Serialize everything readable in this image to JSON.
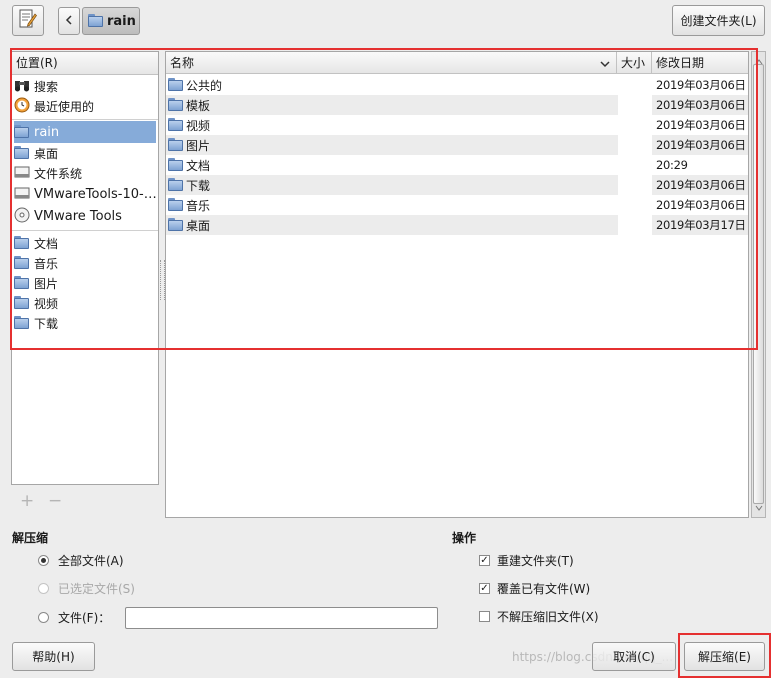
{
  "toolbar": {
    "edit_icon": "edit-document-icon",
    "back_icon": "chevron-left-icon",
    "path_button": "rain",
    "create_folder_button": "创建文件夹(L)"
  },
  "places": {
    "header": "位置(R)",
    "items": [
      {
        "label": "搜索",
        "icon": "binoculars-icon"
      },
      {
        "label": "最近使用的",
        "icon": "recent-clock-icon"
      },
      {
        "label": "rain",
        "icon": "home-folder-icon",
        "selected": true
      },
      {
        "label": "桌面",
        "icon": "desktop-folder-icon"
      },
      {
        "label": "文件系统",
        "icon": "drive-icon"
      },
      {
        "label": "VMwareTools-10-…",
        "icon": "drive-icon"
      },
      {
        "label": "VMware Tools",
        "icon": "cdrom-icon"
      },
      {
        "label": "文档",
        "icon": "documents-folder-icon"
      },
      {
        "label": "音乐",
        "icon": "music-folder-icon"
      },
      {
        "label": "图片",
        "icon": "pictures-folder-icon"
      },
      {
        "label": "视频",
        "icon": "videos-folder-icon"
      },
      {
        "label": "下载",
        "icon": "downloads-folder-icon"
      }
    ],
    "add_label": "+",
    "remove_label": "−"
  },
  "files": {
    "columns": {
      "name": "名称",
      "size": "大小",
      "modified": "修改日期"
    },
    "rows": [
      {
        "name": "公共的",
        "modified": "2019年03月06日"
      },
      {
        "name": "模板",
        "modified": "2019年03月06日"
      },
      {
        "name": "视频",
        "modified": "2019年03月06日"
      },
      {
        "name": "图片",
        "modified": "2019年03月06日"
      },
      {
        "name": "文档",
        "modified": "20:29"
      },
      {
        "name": "下载",
        "modified": "2019年03月06日"
      },
      {
        "name": "音乐",
        "modified": "2019年03月06日"
      },
      {
        "name": "桌面",
        "modified": "2019年03月17日"
      }
    ]
  },
  "extract": {
    "title": "解压缩",
    "all_files": "全部文件(A)",
    "selected_files": "已选定文件(S)",
    "files_label": "文件(F)：",
    "files_value": ""
  },
  "actions": {
    "title": "操作",
    "recreate_folders": "重建文件夹(T)",
    "overwrite": "覆盖已有文件(W)",
    "no_older": "不解压缩旧文件(X)"
  },
  "bottom": {
    "help": "帮助(H)",
    "cancel": "取消(C)",
    "extract": "解压缩(E)",
    "watermark": "https://blog.csdn.net/qq_..."
  },
  "colors": {
    "selection": "#86abd9",
    "highlight_box": "#e53030"
  }
}
